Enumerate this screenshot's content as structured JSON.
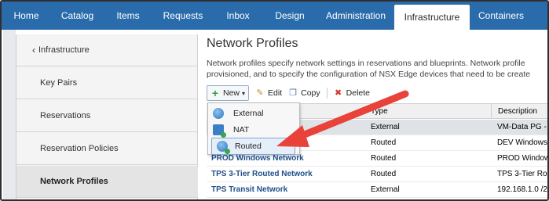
{
  "topnav": {
    "tabs": [
      {
        "label": "Home",
        "active": false
      },
      {
        "label": "Catalog",
        "active": false
      },
      {
        "label": "Items",
        "active": false
      },
      {
        "label": "Requests",
        "active": false
      },
      {
        "label": "Inbox",
        "active": false
      },
      {
        "label": "Design",
        "active": false
      },
      {
        "label": "Administration",
        "active": false
      },
      {
        "label": "Infrastructure",
        "active": true
      },
      {
        "label": "Containers",
        "active": false
      }
    ],
    "bg_color": "#2a6cab"
  },
  "sidebar": {
    "back_chevron": "‹",
    "items": [
      {
        "label": "Infrastructure"
      },
      {
        "label": "Key Pairs"
      },
      {
        "label": "Reservations"
      },
      {
        "label": "Reservation Policies"
      },
      {
        "label": "Network Profiles",
        "active": true
      }
    ]
  },
  "main": {
    "title": "Network Profiles",
    "description_line1": "Network profiles specify network settings in reservations and blueprints. Network profile",
    "description_line2": "provisioned, and to specify the configuration of NSX Edge devices that need to be create",
    "toolbar": {
      "new_label": "New",
      "new_caret": "▾",
      "edit_label": "Edit",
      "copy_label": "Copy",
      "delete_label": "Delete"
    },
    "grid": {
      "columns": [
        "Type",
        "Description"
      ],
      "rows": [
        {
          "name": "",
          "type": "External",
          "description": "VM-Data PG -",
          "selected": true
        },
        {
          "name": "",
          "type": "Routed",
          "description": "DEV Windows",
          "selected": false
        },
        {
          "name": "PROD Windows Network",
          "type": "Routed",
          "description": "PROD Window",
          "selected": false
        },
        {
          "name": "TPS 3-Tier Routed Network",
          "type": "Routed",
          "description": "TPS 3-Tier Ro",
          "selected": false
        },
        {
          "name": "TPS Transit Network",
          "type": "External",
          "description": "192.168.1.0 /2",
          "selected": false
        }
      ]
    }
  },
  "new_menu": {
    "items": [
      {
        "label": "External",
        "icon": "globe-icon"
      },
      {
        "label": "NAT",
        "icon": "nat-icon"
      },
      {
        "label": "Routed",
        "icon": "routed-icon",
        "highlighted": true
      }
    ]
  },
  "annotation": {
    "arrow_color": "#e8423a"
  }
}
